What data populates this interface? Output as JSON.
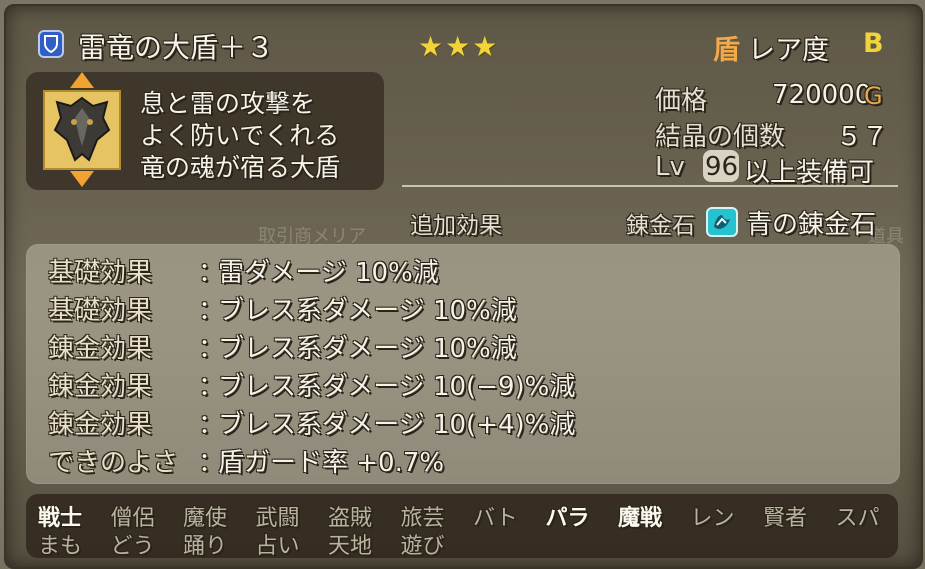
{
  "item": {
    "name": "雷竜の大盾＋３",
    "stars": "★★★",
    "category_icon": "shield-icon",
    "description": [
      "息と雷の攻撃を",
      "よく防いでくれる",
      "竜の魂が宿る大盾"
    ],
    "rarity_type": "盾",
    "rarity_label": "レア度",
    "rarity_rank": "B"
  },
  "stats": {
    "price_label": "価格",
    "price_value": "720000",
    "price_unit": "G",
    "crystal_label": "結晶の個数",
    "crystal_value": "５７",
    "lv_label": "Lv",
    "lv_value": "96",
    "lv_suffix": "以上装備可"
  },
  "extra": {
    "extra_effect_label": "追加効果",
    "alchemy_stone_label": "錬金石",
    "alchemy_stone_name": "青の錬金石",
    "alchemy_stone_icon": "gem-icon"
  },
  "background_text": {
    "left": "取引商メリア",
    "right": "道具"
  },
  "effects": [
    {
      "type": "基礎効果",
      "sep": "：",
      "text": "雷ダメージ 10%減"
    },
    {
      "type": "基礎効果",
      "sep": "：",
      "text": "ブレス系ダメージ 10%減"
    },
    {
      "type": "錬金効果",
      "sep": "：",
      "text": "ブレス系ダメージ 10%減"
    },
    {
      "type": "錬金効果",
      "sep": "：",
      "text": "ブレス系ダメージ 10(−9)%減"
    },
    {
      "type": "錬金効果",
      "sep": "：",
      "text": "ブレス系ダメージ 10(+4)%減"
    },
    {
      "type": "できのよさ",
      "sep": "：",
      "text": "盾ガード率 +0.7%"
    }
  ],
  "jobs_row1": [
    {
      "label": "戦士",
      "equippable": true
    },
    {
      "label": "僧侶",
      "equippable": false
    },
    {
      "label": "魔使",
      "equippable": false
    },
    {
      "label": "武闘",
      "equippable": false
    },
    {
      "label": "盗賊",
      "equippable": false
    },
    {
      "label": "旅芸",
      "equippable": false
    },
    {
      "label": "バト",
      "equippable": false
    },
    {
      "label": "パラ",
      "equippable": true
    },
    {
      "label": "魔戦",
      "equippable": true
    },
    {
      "label": "レン",
      "equippable": false
    },
    {
      "label": "賢者",
      "equippable": false
    },
    {
      "label": "スパ",
      "equippable": false
    }
  ],
  "jobs_row2": [
    {
      "label": "まも",
      "equippable": false
    },
    {
      "label": "どう",
      "equippable": false
    },
    {
      "label": "踊り",
      "equippable": false
    },
    {
      "label": "占い",
      "equippable": false
    },
    {
      "label": "天地",
      "equippable": false
    },
    {
      "label": "遊び",
      "equippable": false
    }
  ],
  "colors": {
    "text": "#f5f2ea",
    "accent_gold": "#f3d33a",
    "accent_orange": "#f2a94a",
    "stone_cyan": "#27c2cf",
    "badge_blue": "#2f5ec8"
  }
}
